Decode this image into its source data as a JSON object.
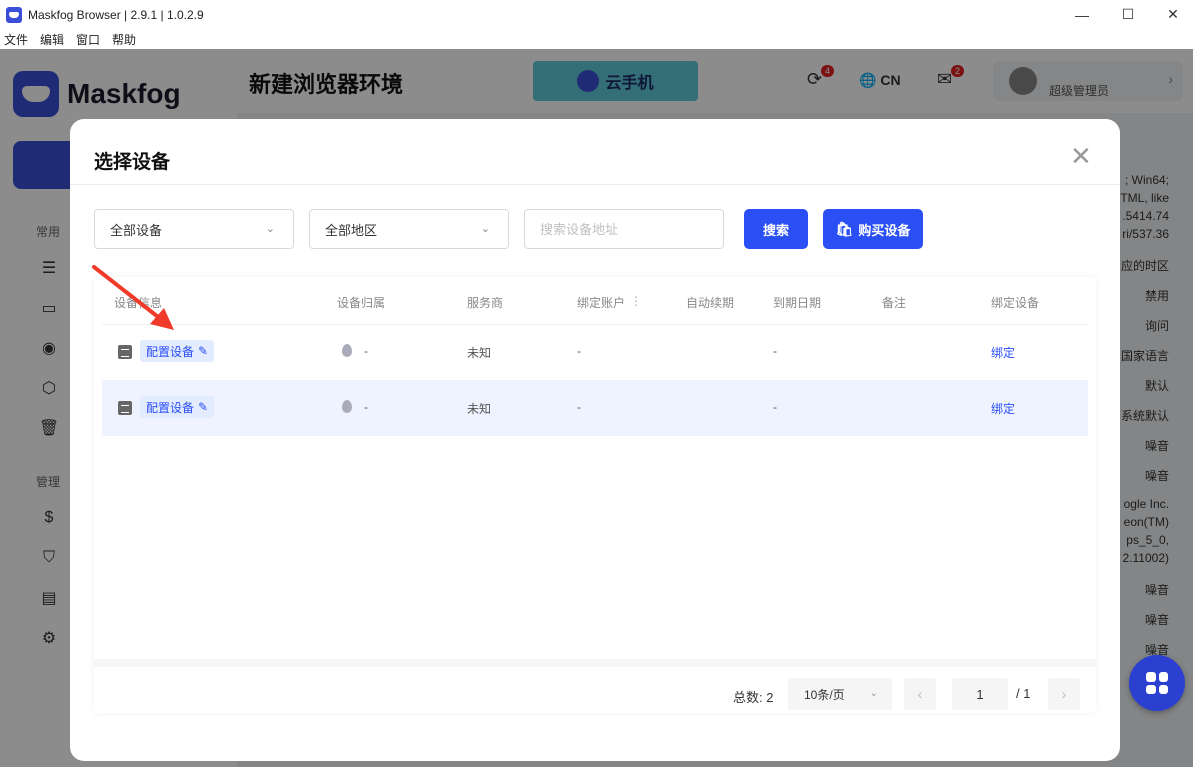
{
  "window": {
    "title": "Maskfog Browser | 2.9.1 | 1.0.2.9",
    "minimize": "—",
    "maximize": "☐",
    "close": "✕"
  },
  "menu": [
    "文件",
    "编辑",
    "窗口",
    "帮助"
  ],
  "sidebar": {
    "logo": "Maskfog",
    "section_common": "常用",
    "section_manage": "管理"
  },
  "topbar": {
    "title": "新建浏览器环境",
    "banner": "云手机",
    "sync_badge": "4",
    "lang": "CN",
    "msg_badge": "2",
    "user_role": "超级管理员"
  },
  "background_text": [
    "; Win64;",
    "TML, like",
    ".5414.74",
    "ri/537.36",
    "应的时区",
    "禁用",
    "询问",
    "国家语言",
    "默认",
    "系统默认",
    "噪音",
    "噪音",
    "ogle Inc.",
    "eon(TM)",
    "ps_5_0,",
    "2.11002)",
    "噪音",
    "噪音",
    "噪音"
  ],
  "modal": {
    "title": "选择设备",
    "close": "✕",
    "filters": {
      "device_select": "全部设备",
      "region_select": "全部地区",
      "search_placeholder": "搜索设备地址",
      "search_button": "搜索",
      "buy_button": "购买设备"
    },
    "table": {
      "headers": [
        "设备信息",
        "设备归属",
        "服务商",
        "绑定账户",
        "自动续期",
        "到期日期",
        "备注",
        "绑定设备"
      ],
      "rows": [
        {
          "config": "配置设备",
          "location": "-",
          "provider": "未知",
          "account": "-",
          "renew": "",
          "expire": "-",
          "note": "",
          "action": "绑定"
        },
        {
          "config": "配置设备",
          "location": "-",
          "provider": "未知",
          "account": "-",
          "renew": "",
          "expire": "-",
          "note": "",
          "action": "绑定"
        }
      ]
    },
    "pagination": {
      "total": "总数: 2",
      "page_size": "10条/页",
      "prev": "‹",
      "current": "1",
      "pages": "/ 1",
      "next": "›"
    }
  },
  "colors": {
    "accent": "#2a4ff5",
    "brand": "#3b4fd8",
    "badge": "#e02020"
  }
}
